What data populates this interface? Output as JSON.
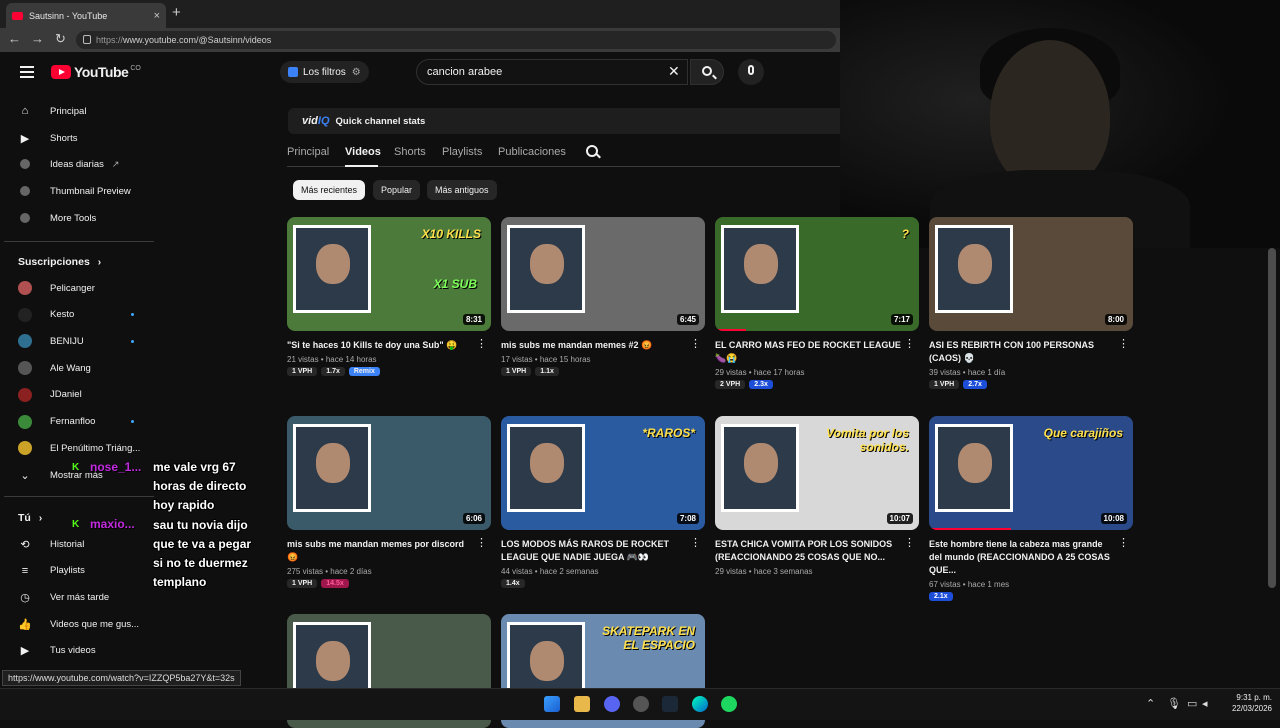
{
  "browser": {
    "tab_title": "Sautsinn - YouTube",
    "tab_close": "×",
    "new_tab": "+",
    "url_prefix": "https://",
    "url": "www.youtube.com/@Sautsinn/videos",
    "status_url": "https://www.youtube.com/watch?v=IZZQP5ba27Y&t=32s"
  },
  "topbar": {
    "logo_text": "YouTube",
    "logo_country": "CO",
    "filters_label": "Los filtros",
    "search_value": "cancion arabee"
  },
  "sidebar": {
    "main_items": [
      {
        "label": "Principal",
        "icon": "home-icon"
      },
      {
        "label": "Shorts",
        "icon": "shorts-icon"
      },
      {
        "label": "Ideas diarias",
        "icon": "vidiq-icon"
      },
      {
        "label": "Thumbnail Preview",
        "icon": "vidiq-icon"
      },
      {
        "label": "More Tools",
        "icon": "vidiq-icon"
      }
    ],
    "subs_header": "Suscripciones",
    "subs": [
      {
        "label": "Pelicanger",
        "color": "#b05050",
        "dot": false
      },
      {
        "label": "Kesto",
        "color": "#222222",
        "dot": true
      },
      {
        "label": "BENIJU",
        "color": "#2f6f8f",
        "dot": true
      },
      {
        "label": "Ale Wang",
        "color": "#555555",
        "dot": false
      },
      {
        "label": "JDaniel",
        "color": "#8a2020",
        "dot": false
      },
      {
        "label": "Fernanfloo",
        "color": "#3a8a3a",
        "dot": true
      },
      {
        "label": "El Penúltimo Triáng...",
        "color": "#c9a227",
        "dot": false
      }
    ],
    "show_more": "Mostrar más",
    "you_header": "Tú",
    "you_items": [
      {
        "label": "Historial",
        "icon": "history-icon"
      },
      {
        "label": "Playlists",
        "icon": "playlists-icon"
      },
      {
        "label": "Ver más tarde",
        "icon": "clock-icon"
      },
      {
        "label": "Videos que me gus...",
        "icon": "thumbs-up-icon"
      },
      {
        "label": "Tus videos",
        "icon": "your-videos-icon"
      }
    ]
  },
  "chat": {
    "user1": "nose_1...",
    "user2": "maxio...",
    "message_lines": [
      "me vale vrg 67",
      "horas de directo",
      "hoy rapido",
      "sau tu novia dijo",
      "que te va a pegar",
      "si no te duermez",
      "templano"
    ]
  },
  "vidiq": {
    "logo_a": "vid",
    "logo_b": "IQ",
    "label": "Quick channel stats"
  },
  "channel_tabs": [
    "Principal",
    "Videos",
    "Shorts",
    "Playlists",
    "Publicaciones"
  ],
  "active_tab": "Videos",
  "sort_chips": [
    "Más recientes",
    "Popular",
    "Más antiguos"
  ],
  "videos": [
    {
      "title": "\"Si te haces 10 Kills te doy una Sub\" 🤑",
      "views": "21 vistas • hace 14 horas",
      "duration": "8:31",
      "badges": [
        {
          "t": "1 VPH",
          "c": ""
        },
        {
          "t": "1.7x",
          "c": ""
        },
        {
          "t": "Remix",
          "c": "blue"
        }
      ],
      "bg": "#4b7a3a",
      "overlay": "X10 KILLS",
      "overlay2": "X1 SUB",
      "progress": 0
    },
    {
      "title": "mis subs me mandan memes #2 😡",
      "views": "17 vistas • hace 15 horas",
      "duration": "6:45",
      "badges": [
        {
          "t": "1 VPH",
          "c": ""
        },
        {
          "t": "1.1x",
          "c": ""
        }
      ],
      "bg": "#6a6a6a",
      "overlay": "",
      "overlay2": "",
      "progress": 0
    },
    {
      "title": "EL CARRO MAS FEO DE ROCKET LEAGUE 🍆😭",
      "views": "29 vistas • hace 17 horas",
      "duration": "7:17",
      "badges": [
        {
          "t": "2 VPH",
          "c": ""
        },
        {
          "t": "2.3x",
          "c": "teal"
        }
      ],
      "bg": "#3a6a2a",
      "overlay": "?",
      "overlay2": "",
      "progress": 0.15
    },
    {
      "title": "ASI ES REBIRTH CON 100 PERSONAS (CAOS) 💀",
      "views": "39 vistas • hace 1 día",
      "duration": "8:00",
      "badges": [
        {
          "t": "1 VPH",
          "c": ""
        },
        {
          "t": "2.7x",
          "c": "teal"
        }
      ],
      "bg": "#5a4a3a",
      "overlay": "",
      "overlay2": "",
      "progress": 0
    },
    {
      "title": "mis subs me mandan memes por discord 😡",
      "views": "275 vistas • hace 2 días",
      "duration": "6:06",
      "badges": [
        {
          "t": "1 VPH",
          "c": ""
        },
        {
          "t": "14.5x",
          "c": "pink"
        }
      ],
      "bg": "#3a5a6a",
      "overlay": "",
      "overlay2": "",
      "progress": 0
    },
    {
      "title": "LOS MODOS MÁS RAROS DE ROCKET LEAGUE QUE NADIE JUEGA 🎮👀",
      "views": "44 vistas • hace 2 semanas",
      "duration": "7:08",
      "badges": [
        {
          "t": "1.4x",
          "c": ""
        }
      ],
      "bg": "#2a5aa0",
      "overlay": "*RAROS*",
      "overlay2": "",
      "progress": 0
    },
    {
      "title": "ESTA CHICA VOMITA POR LOS SONIDOS (REACCIONANDO 25 COSAS QUE NO...",
      "views": "29 vistas • hace 3 semanas",
      "duration": "10:07",
      "badges": [],
      "bg": "#d8d8d8",
      "overlay": "Vomita por los sonidos.",
      "overlay2": "",
      "progress": 0
    },
    {
      "title": "Este hombre tiene la cabeza mas grande del mundo (REACCIONANDO A 25 COSAS QUE...",
      "views": "67 vistas • hace 1 mes",
      "duration": "10:08",
      "badges": [
        {
          "t": "2.1x",
          "c": "teal"
        }
      ],
      "bg": "#2a4a8a",
      "overlay": "Que carajiños",
      "overlay2": "",
      "progress": 0.4
    },
    {
      "title": "",
      "views": "",
      "duration": "",
      "badges": [],
      "bg": "#4a5a4a",
      "overlay": "",
      "overlay2": "",
      "progress": 0
    },
    {
      "title": "",
      "views": "",
      "duration": "",
      "badges": [],
      "bg": "#6a8ab0",
      "overlay": "SKATEPARK EN EL ESPACIO",
      "overlay2": "",
      "progress": 0
    }
  ],
  "clock": {
    "time": "9:31 p. m.",
    "date": "22/03/2026"
  },
  "colors": {
    "accent": "#ff0033",
    "vidiq": "#3b82f6",
    "bg": "#0f0f0f"
  }
}
